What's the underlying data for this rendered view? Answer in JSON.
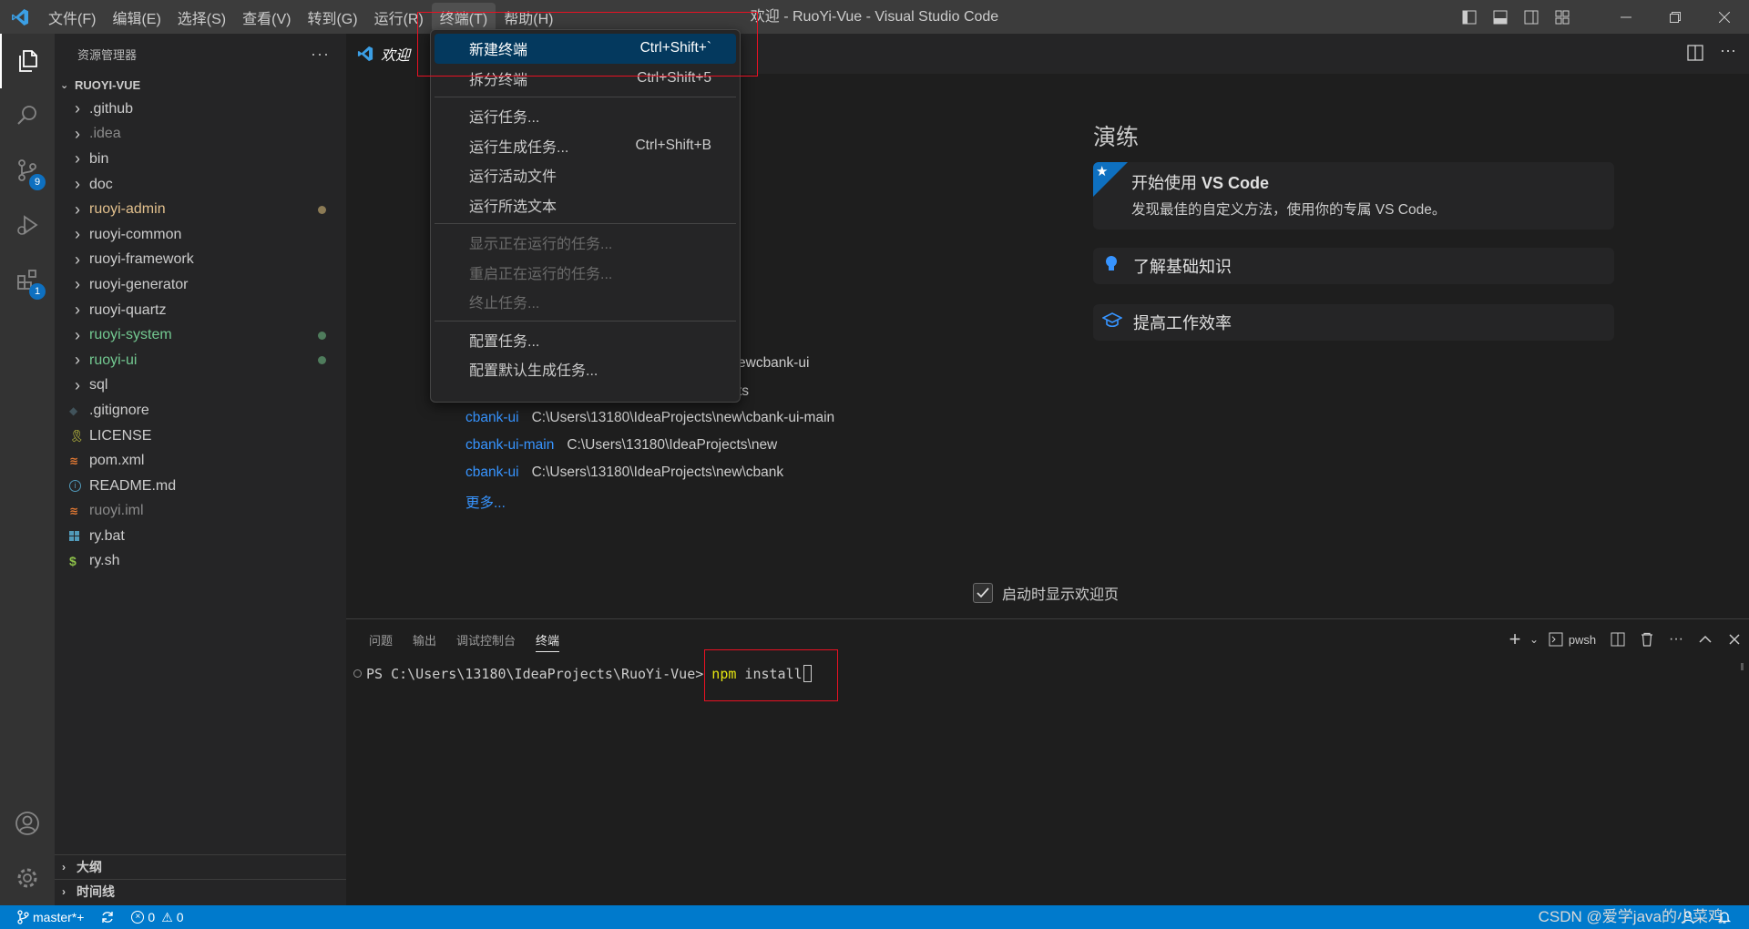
{
  "titlebar": {
    "window_title": "欢迎 - RuoYi-Vue - Visual Studio Code",
    "menus": [
      "文件(F)",
      "编辑(E)",
      "选择(S)",
      "查看(V)",
      "转到(G)",
      "运行(R)",
      "终端(T)",
      "帮助(H)"
    ],
    "active_menu": "终端(T)"
  },
  "terminal_menu": {
    "groups": [
      [
        {
          "label": "新建终端",
          "key": "Ctrl+Shift+`",
          "state": "highlighted"
        },
        {
          "label": "拆分终端",
          "key": "Ctrl+Shift+5",
          "state": "normal"
        }
      ],
      [
        {
          "label": "运行任务...",
          "key": "",
          "state": "normal"
        },
        {
          "label": "运行生成任务...",
          "key": "Ctrl+Shift+B",
          "state": "normal"
        },
        {
          "label": "运行活动文件",
          "key": "",
          "state": "normal"
        },
        {
          "label": "运行所选文本",
          "key": "",
          "state": "normal"
        }
      ],
      [
        {
          "label": "显示正在运行的任务...",
          "key": "",
          "state": "disabled"
        },
        {
          "label": "重启正在运行的任务...",
          "key": "",
          "state": "disabled"
        },
        {
          "label": "终止任务...",
          "key": "",
          "state": "disabled"
        }
      ],
      [
        {
          "label": "配置任务...",
          "key": "",
          "state": "normal"
        },
        {
          "label": "配置默认生成任务...",
          "key": "",
          "state": "normal"
        }
      ]
    ]
  },
  "activity": {
    "scm_badge": "9",
    "extensions_badge": "1"
  },
  "sidebar": {
    "title": "资源管理器",
    "project": "RUOYI-VUE",
    "items": [
      {
        "label": ".github",
        "type": "folder",
        "color": "#cccccc",
        "dot": ""
      },
      {
        "label": ".idea",
        "type": "folder",
        "color": "#8b8b8b",
        "dot": ""
      },
      {
        "label": "bin",
        "type": "folder",
        "color": "#cccccc",
        "dot": ""
      },
      {
        "label": "doc",
        "type": "folder",
        "color": "#cccccc",
        "dot": ""
      },
      {
        "label": "ruoyi-admin",
        "type": "folder",
        "color": "#e2c08d",
        "dot": "#8c7b55"
      },
      {
        "label": "ruoyi-common",
        "type": "folder",
        "color": "#cccccc",
        "dot": ""
      },
      {
        "label": "ruoyi-framework",
        "type": "folder",
        "color": "#cccccc",
        "dot": ""
      },
      {
        "label": "ruoyi-generator",
        "type": "folder",
        "color": "#cccccc",
        "dot": ""
      },
      {
        "label": "ruoyi-quartz",
        "type": "folder",
        "color": "#cccccc",
        "dot": ""
      },
      {
        "label": "ruoyi-system",
        "type": "folder",
        "color": "#73c991",
        "dot": "#4f7c5c"
      },
      {
        "label": "ruoyi-ui",
        "type": "folder",
        "color": "#73c991",
        "dot": "#4f7c5c"
      },
      {
        "label": "sql",
        "type": "folder",
        "color": "#cccccc",
        "dot": ""
      },
      {
        "label": ".gitignore",
        "type": "file",
        "icon": "gitignore-icon",
        "color": "#cccccc",
        "dot": ""
      },
      {
        "label": "LICENSE",
        "type": "file",
        "icon": "license-icon",
        "color": "#cccccc",
        "dot": ""
      },
      {
        "label": "pom.xml",
        "type": "file",
        "icon": "rss-icon",
        "color": "#cccccc",
        "dot": ""
      },
      {
        "label": "README.md",
        "type": "file",
        "icon": "info-icon",
        "color": "#cccccc",
        "dot": ""
      },
      {
        "label": "ruoyi.iml",
        "type": "file",
        "icon": "rss-icon",
        "color": "#8b8b8b",
        "dot": ""
      },
      {
        "label": "ry.bat",
        "type": "file",
        "icon": "windows-icon",
        "color": "#cccccc",
        "dot": ""
      },
      {
        "label": "ry.sh",
        "type": "file",
        "icon": "dollar-icon",
        "color": "#cccccc",
        "dot": ""
      }
    ],
    "outline": "大纲",
    "timeline": "时间线"
  },
  "editor": {
    "tab_label": "欢迎",
    "walkthroughs_heading": "演练",
    "card_start_title_prefix": "开始使用 ",
    "card_start_title_bold": "VS Code",
    "card_start_desc": "发现最佳的自定义方法，使用你的专属 VS Code。",
    "card_basics": "了解基础知识",
    "card_productivity": "提高工作效率",
    "recent_partial_1": "ewcbank-ui",
    "recent_partial_2": "ts",
    "recent": [
      {
        "name": "cbank-ui",
        "path": "C:\\Users\\13180\\IdeaProjects\\new\\cbank-ui-main"
      },
      {
        "name": "cbank-ui-main",
        "path": "C:\\Users\\13180\\IdeaProjects\\new"
      },
      {
        "name": "cbank-ui",
        "path": "C:\\Users\\13180\\IdeaProjects\\new\\cbank"
      }
    ],
    "more": "更多...",
    "show_welcome_label": "启动时显示欢迎页"
  },
  "panel": {
    "tabs": [
      "问题",
      "输出",
      "调试控制台",
      "终端"
    ],
    "active_tab": "终端",
    "shell": "pwsh",
    "prompt": "PS C:\\Users\\13180\\IdeaProjects\\RuoYi-Vue> ",
    "command_keyword": "npm",
    "command_rest": " install"
  },
  "statusbar": {
    "branch": "master*+",
    "errors": "0",
    "warnings": "0"
  },
  "watermark": "CSDN @爱学java的小菜鸡",
  "colors": {
    "accent": "#007acc",
    "annotation": "#e81123",
    "menu_highlight": "#04395e",
    "link": "#3794ff"
  }
}
